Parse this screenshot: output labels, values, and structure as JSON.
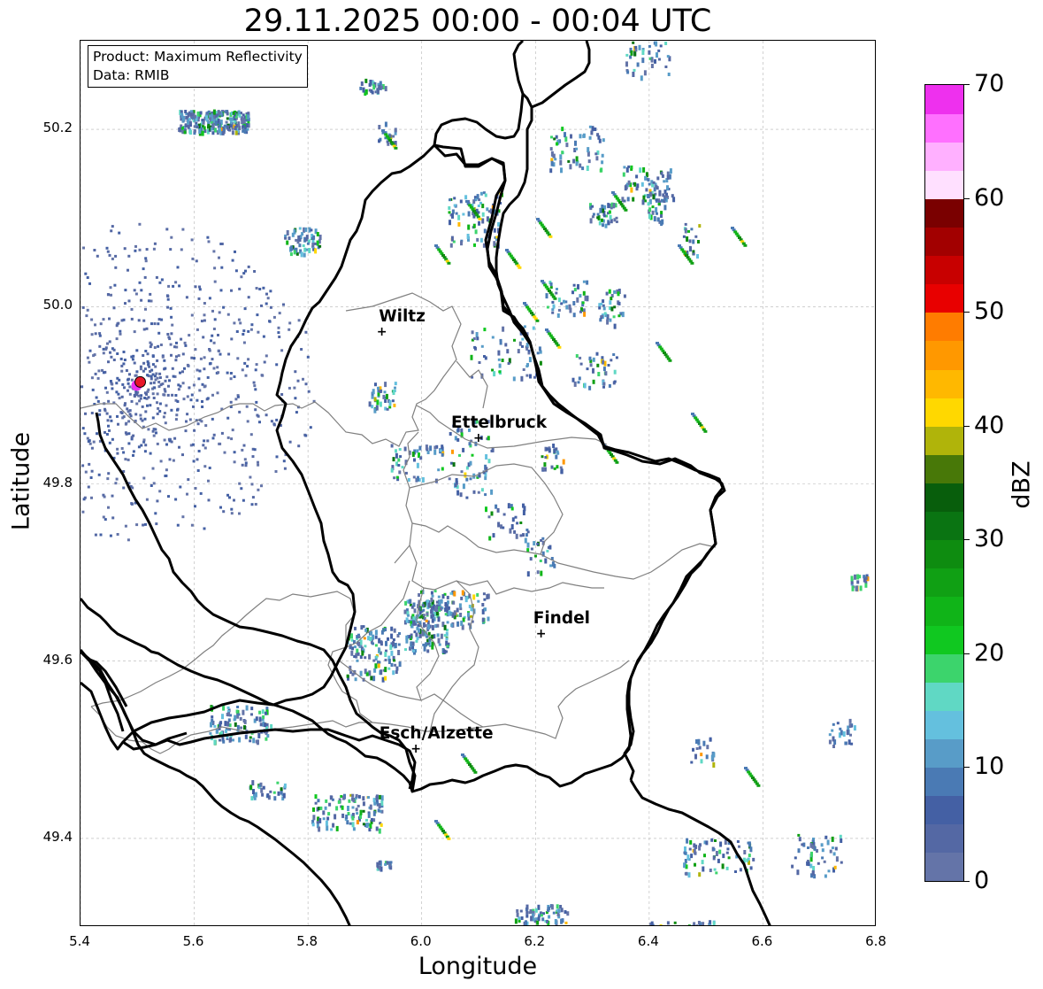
{
  "title": "29.11.2025 00:00 - 00:04 UTC",
  "info_box": {
    "product_line": "Product: Maximum Reflectivity",
    "data_line": "Data: RMIB"
  },
  "axes": {
    "x_label": "Longitude",
    "y_label": "Latitude",
    "x_range": [
      5.4,
      6.8
    ],
    "y_range": [
      49.3,
      50.3
    ],
    "x_ticks": [
      "5.4",
      "5.6",
      "5.8",
      "6.0",
      "6.2",
      "6.4",
      "6.6",
      "6.8"
    ],
    "y_ticks": [
      "49.4",
      "49.6",
      "49.8",
      "50.0",
      "50.2"
    ],
    "grid": true
  },
  "cities": [
    {
      "name": "Wiltz",
      "lon": 5.93,
      "lat": 49.97
    },
    {
      "name": "Ettelbruck",
      "lon": 6.1,
      "lat": 49.85
    },
    {
      "name": "Findel",
      "lon": 6.21,
      "lat": 49.63
    },
    {
      "name": "Esch/Alzette",
      "lon": 5.99,
      "lat": 49.5
    }
  ],
  "radar_site": {
    "lon": 5.505,
    "lat": 49.915,
    "color": "#e8162a"
  },
  "colorbar": {
    "label": "dBZ",
    "ticks": [
      "0",
      "10",
      "20",
      "30",
      "40",
      "50",
      "60",
      "70"
    ],
    "range": [
      0,
      70
    ],
    "step": 2.5,
    "colors": [
      "#6474a8",
      "#5468a4",
      "#4460a4",
      "#4a7ab4",
      "#589cc8",
      "#64c0de",
      "#60d8c4",
      "#3cd46c",
      "#10c820",
      "#10b418",
      "#10a014",
      "#0e8c10",
      "#0a7412",
      "#085e0c",
      "#487808",
      "#b0b40a",
      "#ffd800",
      "#ffb800",
      "#ff9800",
      "#ff7c00",
      "#e80000",
      "#c80000",
      "#a20000",
      "#7a0000",
      "#ffe0ff",
      "#ffb0ff",
      "#ff70ff",
      "#ee30ee"
    ]
  },
  "styles": {
    "border_color": "#000000",
    "district_color": "#808080",
    "grid_color": "#b4b4b4"
  }
}
